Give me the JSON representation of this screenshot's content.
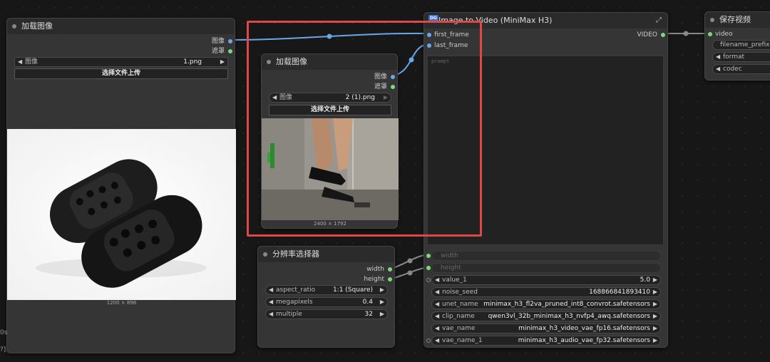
{
  "load_image_1": {
    "title": "加载图像",
    "out_image": "图像",
    "out_mask": "遮罩",
    "widget_label": "图像",
    "widget_value": "1.png",
    "upload_label": "选择文件上传",
    "dimensions": "1200 × 896"
  },
  "load_image_2": {
    "title": "加载图像",
    "out_image": "图像",
    "out_mask": "遮罩",
    "widget_label": "图像",
    "widget_value": "2 (1).png",
    "upload_label": "选择文件上传",
    "dimensions": "2400 × 1792"
  },
  "i2v_node": {
    "badge": "DG",
    "title": "Image to Video (MiniMax H3)",
    "in_first_frame": "first_frame",
    "in_last_frame": "last_frame",
    "out_video": "VIDEO",
    "prompt_placeholder": "prompt",
    "in_width": "width",
    "in_height": "height",
    "widgets": [
      {
        "label": "value_1",
        "value": "5.0"
      },
      {
        "label": "noise_seed",
        "value": "168866841893410"
      },
      {
        "label": "unet_name",
        "value": "minimax_h3_fl2va_pruned_int8_convrot.safetensors"
      },
      {
        "label": "clip_name",
        "value": "qwen3vl_32b_minimax_h3_nvfp4_awq.safetensors"
      },
      {
        "label": "vae_name",
        "value": "minimax_h3_video_vae_fp16.safetensors"
      },
      {
        "label": "vae_name_1",
        "value": "minimax_h3_audio_vae_fp32.safetensors"
      }
    ]
  },
  "resolution_node": {
    "title": "分辨率选择器",
    "out_width": "width",
    "out_height": "height",
    "widgets": [
      {
        "label": "aspect_ratio",
        "value": "1:1 (Square)"
      },
      {
        "label": "megapixels",
        "value": "0.4"
      },
      {
        "label": "multiple",
        "value": "32"
      }
    ]
  },
  "save_video_node": {
    "title": "保存视频",
    "in_video": "video",
    "widgets": [
      {
        "label": "filename_prefix"
      },
      {
        "label": "format"
      },
      {
        "label": "codec"
      }
    ]
  },
  "side_fragments": {
    "frag1": "0s",
    "frag2": "?]"
  },
  "colors": {
    "highlight": "#e04848",
    "link_image": "#6aa6e8",
    "link_int": "#7dd87d"
  }
}
